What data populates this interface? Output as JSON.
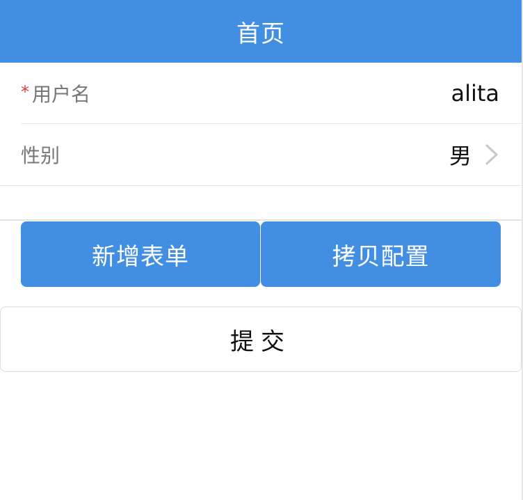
{
  "navbar": {
    "title": "首页"
  },
  "form": {
    "username": {
      "required_mark": "*",
      "label": "用户名",
      "value": "alita"
    },
    "gender": {
      "label": "性别",
      "value": "男",
      "icon": "chevron-right-icon"
    }
  },
  "actions": {
    "add_form_label": "新增表单",
    "copy_config_label": "拷贝配置",
    "submit_label": "提交"
  },
  "colors": {
    "primary": "#418ee3",
    "required": "#e4393c",
    "label": "#777777",
    "border": "#e4e4e4"
  }
}
